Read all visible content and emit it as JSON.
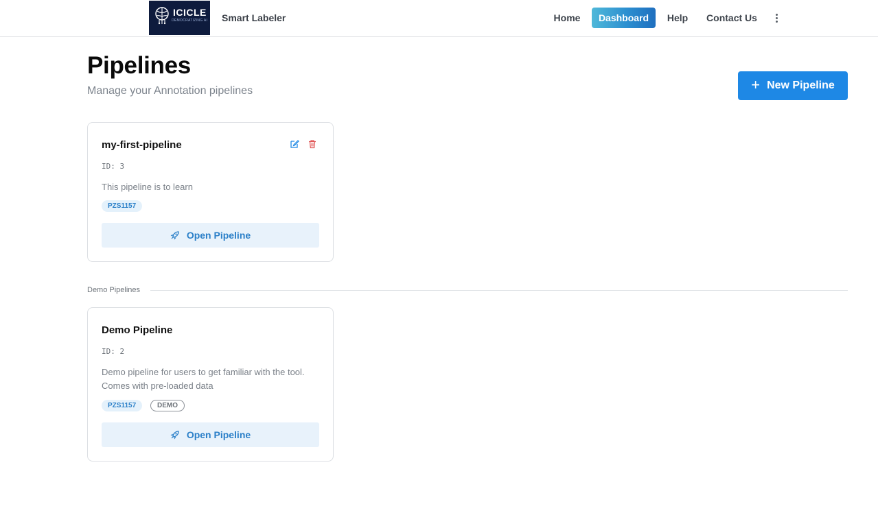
{
  "header": {
    "logo_text": "ICICLE",
    "logo_subtext": "DEMOCRATIZING AI",
    "app_name": "Smart Labeler",
    "nav": [
      {
        "label": "Home",
        "active": false
      },
      {
        "label": "Dashboard",
        "active": true
      },
      {
        "label": "Help",
        "active": false
      },
      {
        "label": "Contact Us",
        "active": false
      }
    ],
    "more_icon": "vertical-dots-icon"
  },
  "page": {
    "title": "Pipelines",
    "subtitle": "Manage your Annotation pipelines",
    "new_button_label": "New Pipeline",
    "new_button_icon": "plus-icon"
  },
  "pipelines": [
    {
      "name": "my-first-pipeline",
      "id_text": "ID: 3",
      "description": "This pipeline is to learn",
      "tags": [
        "PZS1157"
      ],
      "open_label": "Open Pipeline",
      "editable": true
    }
  ],
  "demo_section": {
    "label": "Demo Pipelines",
    "pipelines": [
      {
        "name": "Demo Pipeline",
        "id_text": "ID: 2",
        "description": "Demo pipeline for users to get familiar with the tool. Comes with pre-loaded data",
        "tags": [
          "PZS1157"
        ],
        "demo_badge": "DEMO",
        "open_label": "Open Pipeline"
      }
    ]
  },
  "colors": {
    "primary": "#1e88e5",
    "delete": "#e05252",
    "accent_light": "#e8f2fb"
  }
}
